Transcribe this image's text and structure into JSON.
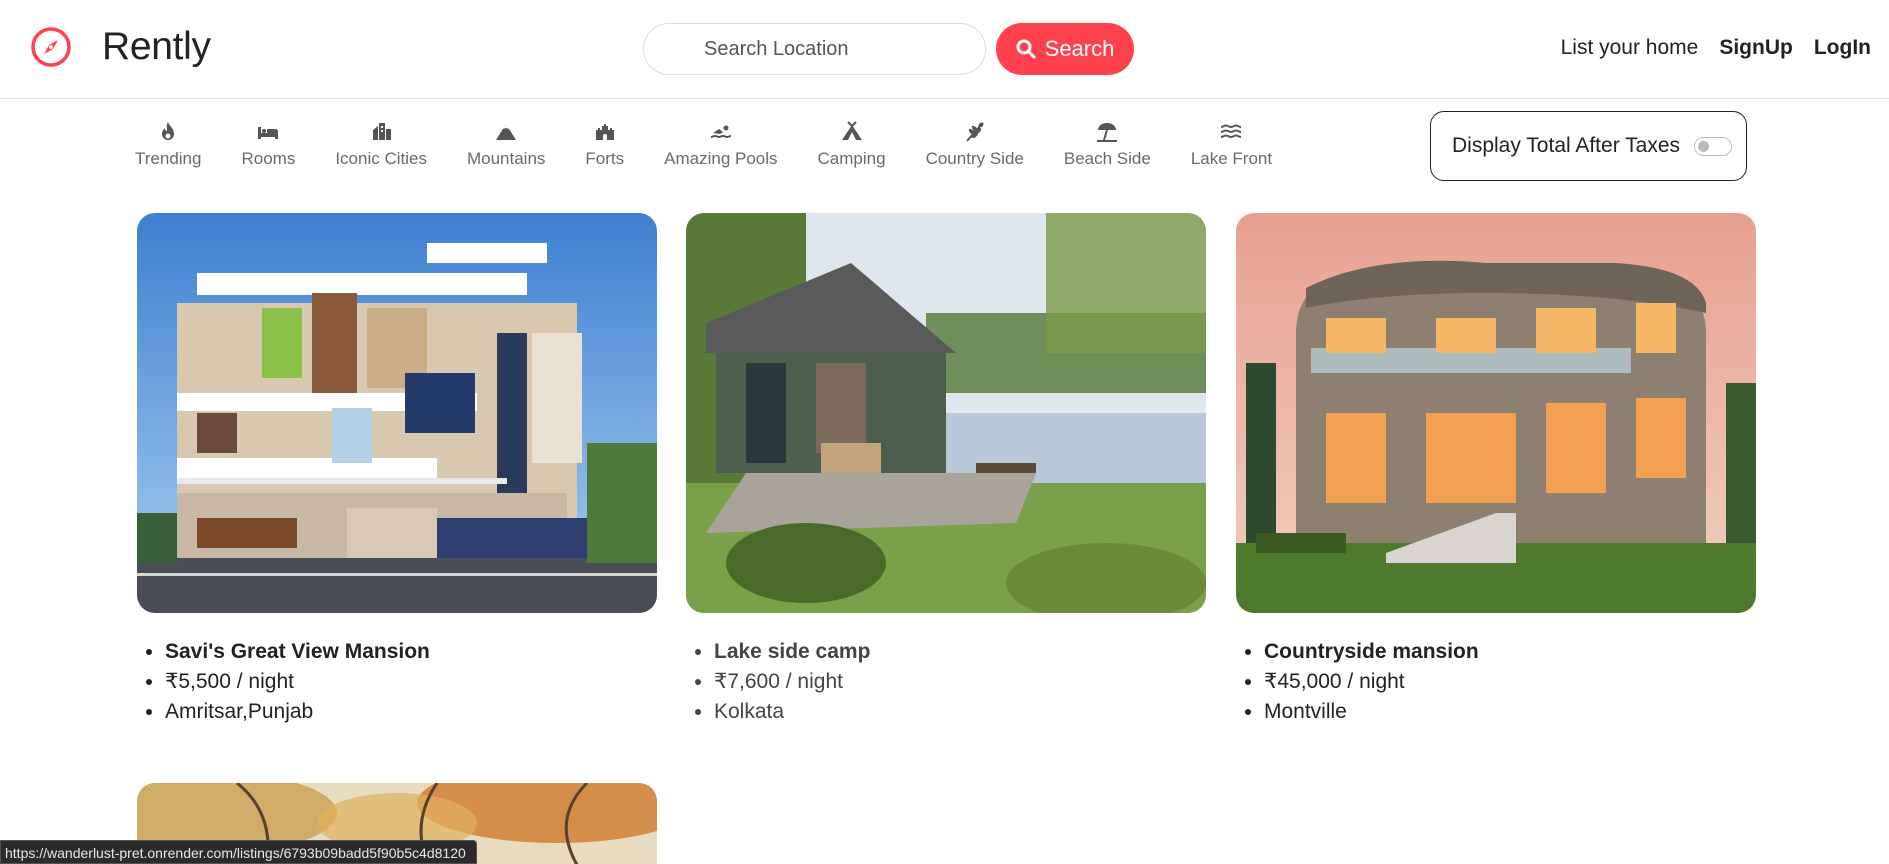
{
  "brand": {
    "name": "Rently",
    "icon": "compass-icon",
    "color": "#fe424d"
  },
  "search": {
    "placeholder": "Search Location",
    "button_label": "Search",
    "button_color": "#fe424d"
  },
  "nav": {
    "list_home": "List your home",
    "signup": "SignUp",
    "login": "LogIn"
  },
  "filters": [
    {
      "label": "Trending",
      "icon": "fire-icon"
    },
    {
      "label": "Rooms",
      "icon": "bed-icon"
    },
    {
      "label": "Iconic Cities",
      "icon": "city-icon"
    },
    {
      "label": "Mountains",
      "icon": "mountain-icon"
    },
    {
      "label": "Forts",
      "icon": "fort-icon"
    },
    {
      "label": "Amazing Pools",
      "icon": "swimmer-icon"
    },
    {
      "label": "Camping",
      "icon": "campground-icon"
    },
    {
      "label": "Country Side",
      "icon": "wheat-icon"
    },
    {
      "label": "Beach Side",
      "icon": "umbrella-beach-icon"
    },
    {
      "label": "Lake Front",
      "icon": "water-icon"
    }
  ],
  "tax_toggle": {
    "label": "Display Total After Taxes",
    "checked": false
  },
  "listings": [
    {
      "title": "Savi's Great View Mansion",
      "price": "₹5,500 / night",
      "location": "Amritsar,Punjab"
    },
    {
      "title": "Lake side camp",
      "price": "₹7,600 / night",
      "location": "Kolkata"
    },
    {
      "title": "Countryside mansion",
      "price": "₹45,000 / night",
      "location": "Montville"
    }
  ],
  "status_url": "https://wanderlust-pret.onrender.com/listings/6793b09badd5f90b5c4d8120"
}
